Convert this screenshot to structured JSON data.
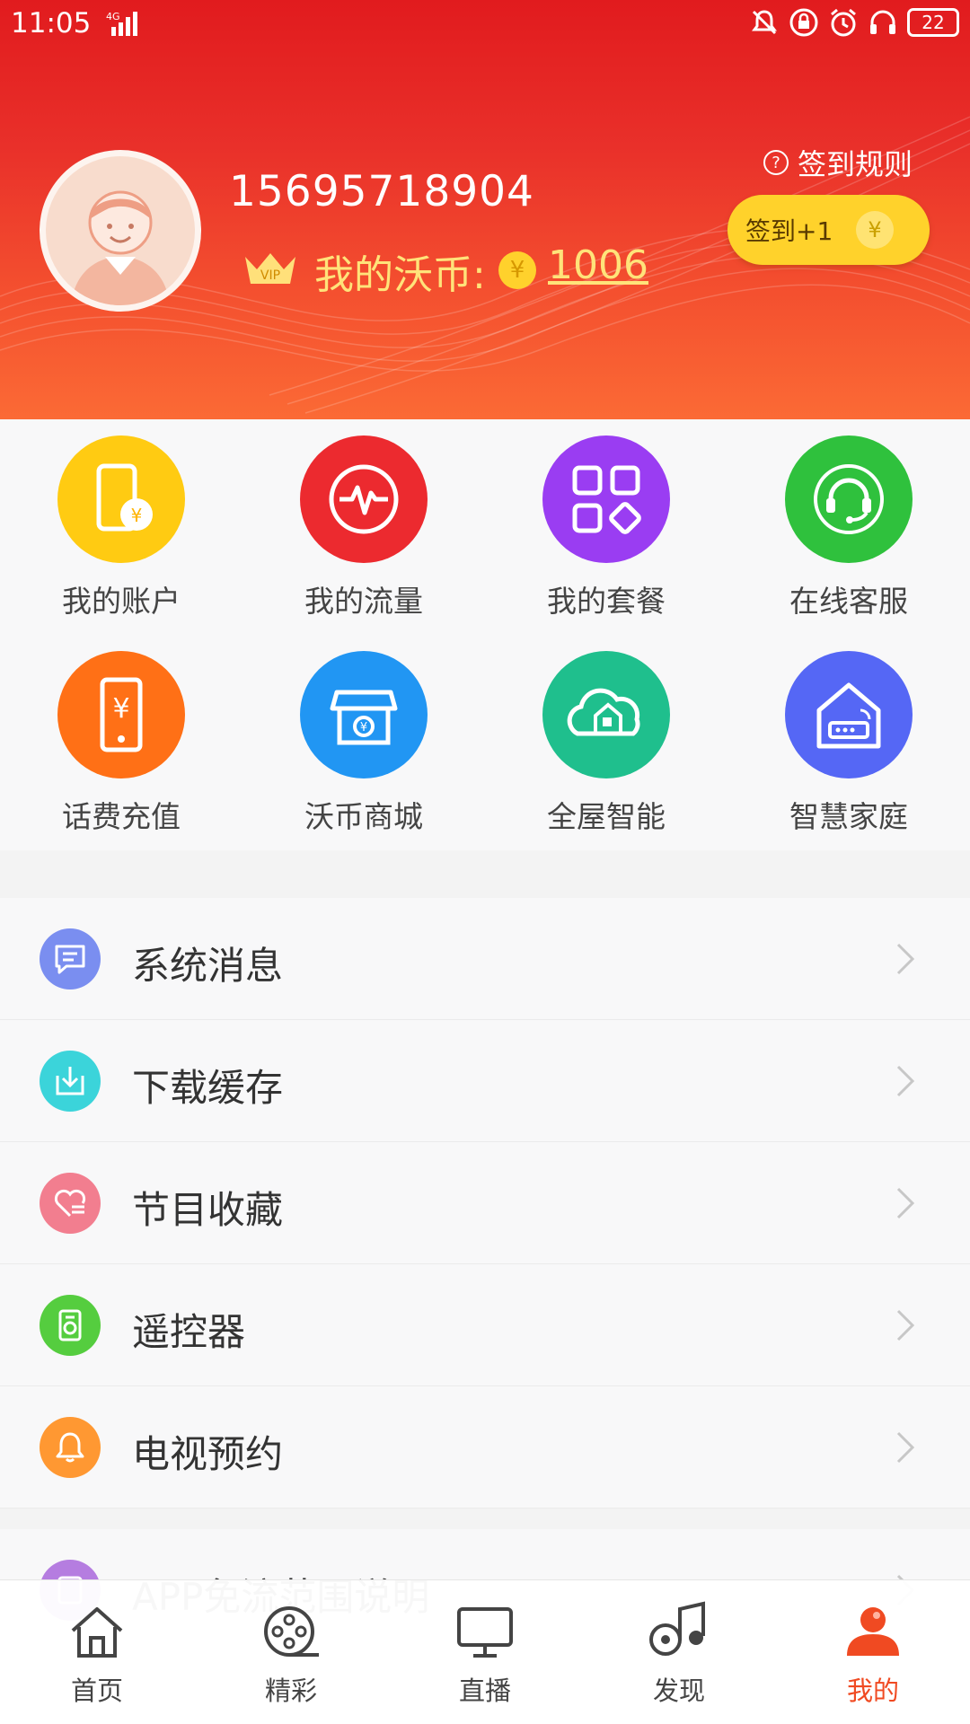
{
  "status_bar": {
    "time": "11:05",
    "network": "4G",
    "battery": "22"
  },
  "profile": {
    "phone": "15695718904",
    "vip_badge": "VIP",
    "coin_label": "我的沃币:",
    "coin_symbol": "¥",
    "coin_value": "1006",
    "signin_rules": "签到规则",
    "signin_button": "签到+1"
  },
  "grid": [
    {
      "label": "我的账户",
      "icon": "account-icon",
      "color": "#ffcb12"
    },
    {
      "label": "我的流量",
      "icon": "traffic-icon",
      "color": "#ec2a2f"
    },
    {
      "label": "我的套餐",
      "icon": "package-icon",
      "color": "#9a3df2"
    },
    {
      "label": "在线客服",
      "icon": "headset-icon",
      "color": "#2fc13d"
    },
    {
      "label": "话费充值",
      "icon": "recharge-icon",
      "color": "#ff7016"
    },
    {
      "label": "沃币商城",
      "icon": "store-icon",
      "color": "#2196f3"
    },
    {
      "label": "全屋智能",
      "icon": "smart-home-icon",
      "color": "#1fbf8d"
    },
    {
      "label": "智慧家庭",
      "icon": "router-home-icon",
      "color": "#5567f5"
    }
  ],
  "menu": [
    {
      "label": "系统消息",
      "icon": "message-icon",
      "color": "#7a8ef0"
    },
    {
      "label": "下载缓存",
      "icon": "download-icon",
      "color": "#3bd4da"
    },
    {
      "label": "节目收藏",
      "icon": "favorite-icon",
      "color": "#f27e8f"
    },
    {
      "label": "遥控器",
      "icon": "remote-icon",
      "color": "#55cd3f"
    },
    {
      "label": "电视预约",
      "icon": "bell-icon",
      "color": "#ff9832"
    }
  ],
  "menu_partial": [
    {
      "label": "APP免流范围说明",
      "icon": "info-icon",
      "color": "#b57de0"
    }
  ],
  "bottom_nav": [
    {
      "label": "首页",
      "icon": "home-icon",
      "active": false
    },
    {
      "label": "精彩",
      "icon": "film-reel-icon",
      "active": false
    },
    {
      "label": "直播",
      "icon": "tv-icon",
      "active": false
    },
    {
      "label": "发现",
      "icon": "music-note-icon",
      "active": false
    },
    {
      "label": "我的",
      "icon": "user-icon",
      "active": true
    }
  ],
  "colors": {
    "header_top": "#e11b1e",
    "header_bottom": "#fb6a35",
    "accent": "#f04a22",
    "coin": "#ffd22b"
  }
}
